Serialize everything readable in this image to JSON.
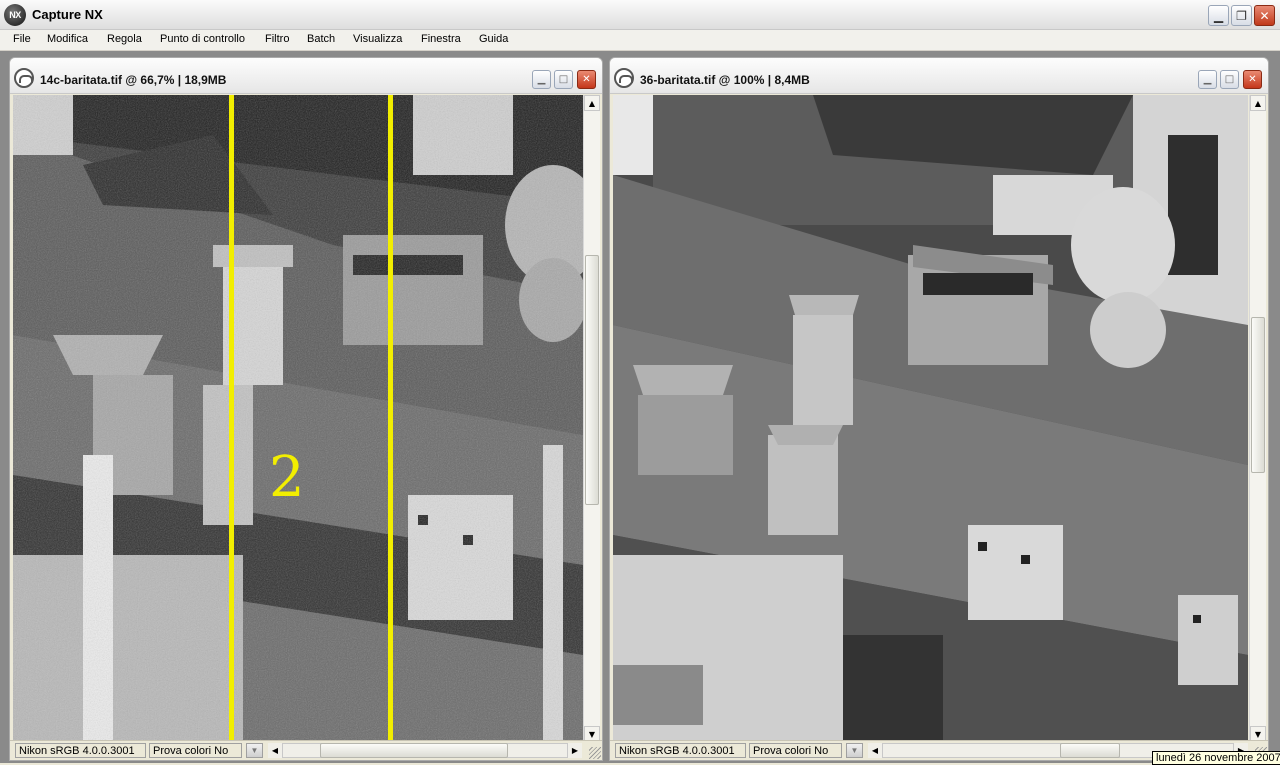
{
  "app": {
    "title": "Capture NX",
    "logo": "NX"
  },
  "window_controls": {
    "minimize": "minimize-icon",
    "restore": "restore-icon",
    "close": "close-icon"
  },
  "menu": [
    "File",
    "Modifica",
    "Regola",
    "Punto di controllo",
    "Filtro",
    "Batch",
    "Visualizza",
    "Finestra",
    "Guida"
  ],
  "documents": [
    {
      "title": "14c-baritata.tif @ 66,7% | 18,9MB",
      "profile": "Nikon sRGB 4.0.0.3001",
      "softproof": "Prova colori No",
      "overlay_number": "2",
      "image": "grainy black-and-white photo of rooftop chimneys and satellite dishes with two yellow vertical guide lines",
      "accent": "#f2ee00"
    },
    {
      "title": "36-baritata.tif @ 100% | 8,4MB",
      "profile": "Nikon sRGB 4.0.0.3001",
      "softproof": "Prova colori No",
      "image": "sharp black-and-white photo of rooftop chimneys and satellite dishes"
    }
  ],
  "tooltip": "lunedì 26 novembre 2007"
}
